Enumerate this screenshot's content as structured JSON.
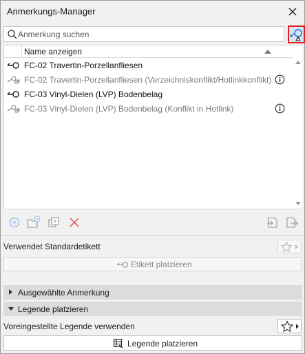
{
  "window": {
    "title": "Anmerkungs-Manager"
  },
  "search": {
    "placeholder": "Anmerkung suchen",
    "value": ""
  },
  "list": {
    "column_header": "Name anzeigen",
    "rows": [
      {
        "label": "FC-02 Travertin-Porzellanfliesen",
        "state": "active",
        "icon": "marker-key-icon",
        "has_info": false
      },
      {
        "label": "FC-02 Travertin-Porzellanfliesen (Verzeichniskonflikt/Hotlinkkonflikt)",
        "state": "inactive",
        "icon": "conflict-marker-icon",
        "has_info": true
      },
      {
        "label": "FC-03 Vinyl-Dielen (LVP) Bodenbelag",
        "state": "active",
        "icon": "marker-key-icon",
        "has_info": false
      },
      {
        "label": "FC-03 Vinyl-Dielen (LVP) Bodenbelag (Konflikt in Hotlink)",
        "state": "inactive",
        "icon": "conflict-marker-icon",
        "has_info": true
      }
    ]
  },
  "standard": {
    "label": "Verwendet Standardetikett",
    "place_button": "Etikett platzieren"
  },
  "sections": {
    "selected": "Ausgewählte Anmerkung",
    "legend": "Legende platzieren"
  },
  "legend": {
    "label": "Voreingestellte Legende verwenden",
    "place_button": "Legende platzieren"
  },
  "colors": {
    "highlight_border": "#e0211b",
    "accent_blue": "#1f6fc5",
    "delete_red": "#e26b6b"
  }
}
